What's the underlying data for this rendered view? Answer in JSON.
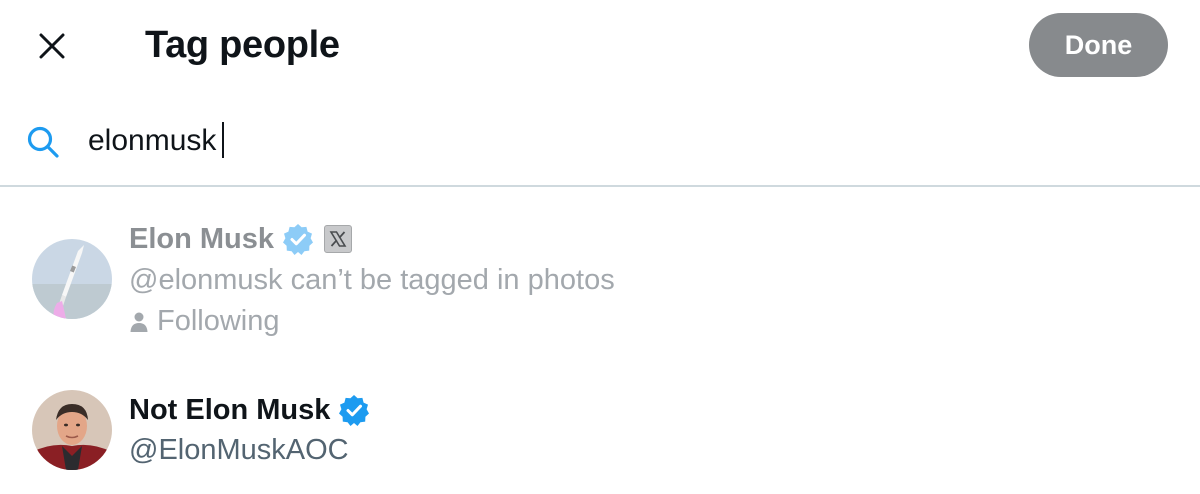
{
  "header": {
    "title": "Tag people",
    "done_label": "Done"
  },
  "search": {
    "value": "elonmusk"
  },
  "results": [
    {
      "name": "Elon Musk",
      "status": "@elonmusk can’t be tagged in photos",
      "relationship": "Following",
      "verified": true,
      "affiliation_icon": "x-logo-icon",
      "disabled": true
    },
    {
      "name": "Not Elon Musk",
      "handle": "@ElonMuskAOC",
      "verified": true,
      "disabled": false
    }
  ],
  "colors": {
    "verified_blue": "#1d9bf0",
    "done_bg": "#878a8d",
    "text_primary": "#0f1419",
    "text_secondary": "#536471",
    "text_disabled": "#a3a8ad",
    "divider": "#cfd9de"
  }
}
